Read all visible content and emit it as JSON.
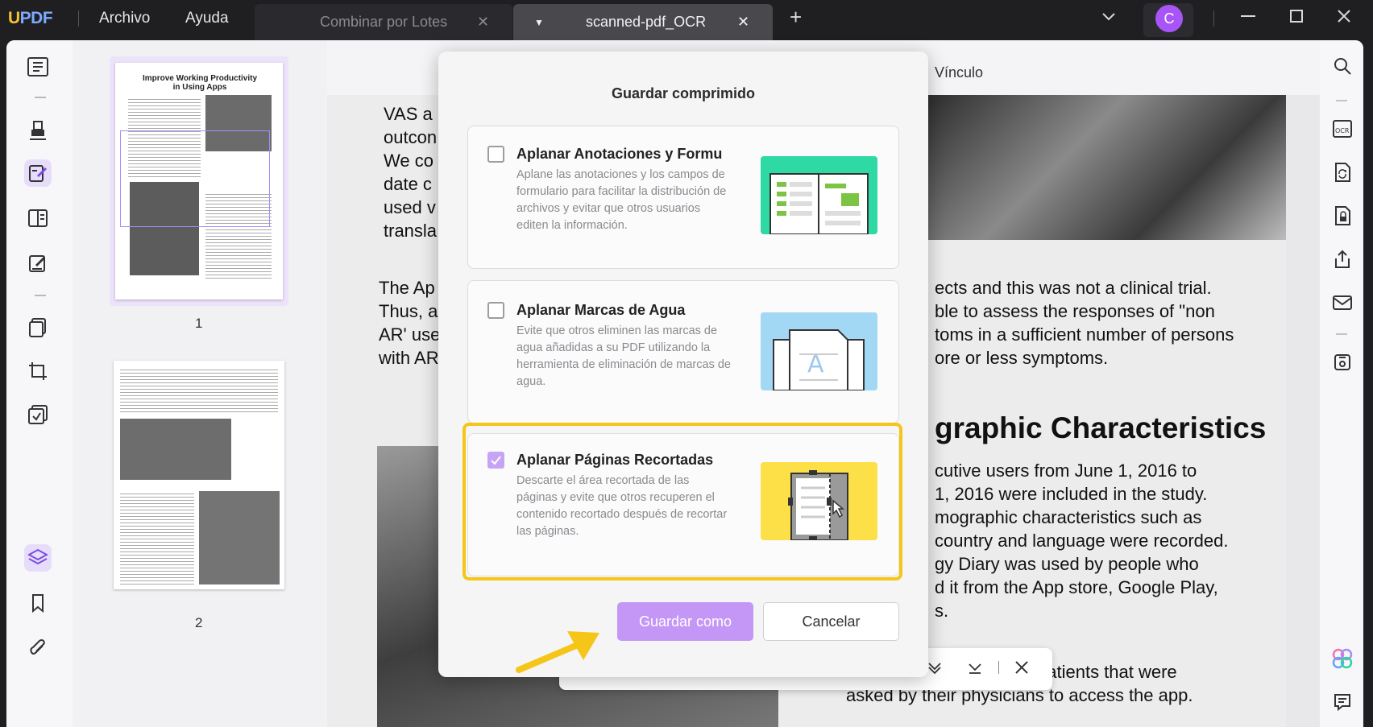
{
  "app": {
    "logo_u": "U",
    "logo_rest": "PDF",
    "menu": [
      "Archivo",
      "Ayuda"
    ],
    "tabs": [
      {
        "label": "Combinar por Lotes",
        "active": false
      },
      {
        "label": "scanned-pdf_OCR",
        "active": true
      }
    ],
    "avatar_initial": "C",
    "accent": "#a855f7"
  },
  "toolbar": {
    "vinculo_label": "Vínculo"
  },
  "thumbnails": [
    {
      "page": "1",
      "title": "Improve Working Productivity in Using Apps"
    },
    {
      "page": "2"
    }
  ],
  "document": {
    "left_fragments": [
      "VAS a",
      "outcon",
      "We  co",
      "date  c",
      "used  v",
      "transla"
    ],
    "left_fragments_2": [
      "The Ap",
      "Thus, a",
      "AR' use",
      "with AR"
    ],
    "right_para_1": [
      "ects and this was not a clinical trial.",
      "ble to assess the responses of \"non",
      "toms in a sufficient number of persons",
      "ore or less symptoms."
    ],
    "heading": "graphic Characteristics",
    "right_para_2": [
      "cutive  users  from  June  1,  2016  to",
      "1,  2016  were  included  in  the  study.",
      "mographic  characteristics  such  as",
      "country and language were recorded.",
      "gy  Diary  was  used  by  people  who",
      "d it from the App store, Google Play,",
      "s."
    ],
    "right_para_3": [
      "clinic  patients  that  were",
      "asked  by  their  physicians  to  access  the  app."
    ]
  },
  "dialog": {
    "title": "Guardar comprimido",
    "options": [
      {
        "title": "Aplanar Anotaciones y Formulario",
        "description": "Aplane las anotaciones y los campos de formulario para facilitar la distribución de archivos y evitar que otros usuarios editen la información.",
        "checked": false
      },
      {
        "title": "Aplanar Marcas de Agua",
        "description": "Evite que otros eliminen las marcas de agua añadidas a su PDF utilizando la herramienta de eliminación de marcas de agua.",
        "checked": false
      },
      {
        "title": "Aplanar Páginas Recortadas",
        "description": "Descarte el área recortada de las páginas y evite que otros recuperen el contenido recortado después de recortar las páginas.",
        "checked": true
      }
    ],
    "save_as_label": "Guardar como",
    "cancel_label": "Cancelar"
  },
  "colors": {
    "primary_button": "#c497f6",
    "highlight": "#f5c518",
    "arrow": "#f5c518"
  }
}
